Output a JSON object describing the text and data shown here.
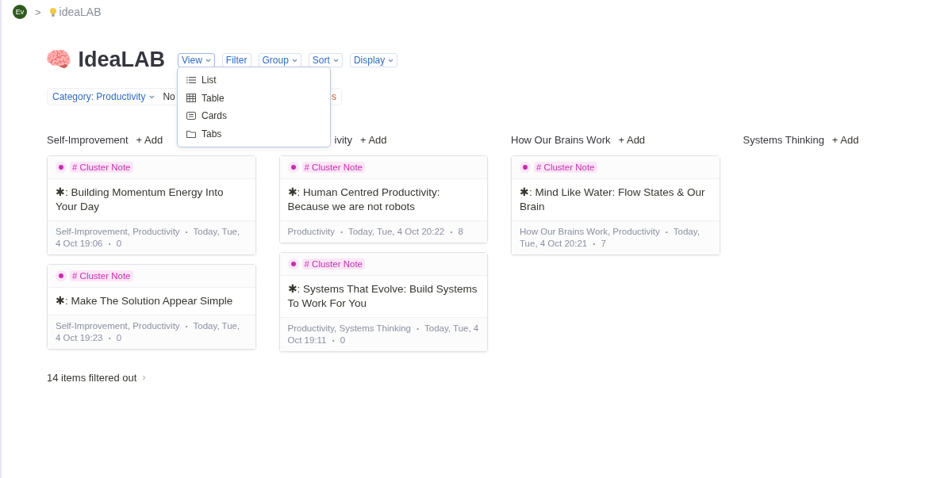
{
  "breadcrumb": {
    "avatar": "Ev",
    "separator": ">",
    "page": "ideaLAB"
  },
  "title": {
    "emoji": "🧠",
    "text": "IdeaLAB"
  },
  "meta_separator": "•",
  "toolbar": [
    {
      "label": "View",
      "caret": true,
      "selected": true
    },
    {
      "label": "Filter",
      "caret": false,
      "selected": false
    },
    {
      "label": "Group",
      "caret": true,
      "selected": false
    },
    {
      "label": "Sort",
      "caret": true,
      "selected": false
    },
    {
      "label": "Display",
      "caret": true,
      "selected": false
    }
  ],
  "filters": [
    {
      "kind": "dropdown",
      "label": "Category: Productivity"
    },
    {
      "kind": "plain",
      "label": "No"
    },
    {
      "kind": "warning",
      "label": "s"
    }
  ],
  "view_menu": [
    {
      "kind": "list",
      "label": "List"
    },
    {
      "kind": "table",
      "label": "Table"
    },
    {
      "kind": "cards",
      "label": "Cards"
    },
    {
      "kind": "tabs",
      "label": "Tabs"
    }
  ],
  "columns": [
    {
      "title": "Self-Improvement",
      "add": "+ Add",
      "cards": [
        {
          "tag": "# Cluster Note",
          "title": "✱: Building Momentum Energy Into Your Day",
          "meta": [
            "Self-Improvement, Productivity",
            "Today, Tue, 4 Oct 19:06",
            "0"
          ]
        },
        {
          "tag": "# Cluster Note",
          "title": "✱: Make The Solution Appear Simple",
          "meta": [
            "Self-Improvement, Productivity",
            "Today, Tue, 4 Oct 19:23",
            "0"
          ]
        }
      ]
    },
    {
      "title": "ivity",
      "add": "+ Add",
      "cards": [
        {
          "tag": "# Cluster Note",
          "title": "✱: Human Centred Productivity: Because we are not robots",
          "meta": [
            "Productivity",
            "Today, Tue, 4 Oct 20:22",
            "8"
          ]
        },
        {
          "tag": "# Cluster Note",
          "title": "✱: Systems That Evolve: Build Systems To Work For You",
          "meta": [
            "Productivity, Systems Thinking",
            "Today, Tue, 4 Oct 19:11",
            "0"
          ]
        }
      ]
    },
    {
      "title": "How Our Brains Work",
      "add": "+ Add",
      "cards": [
        {
          "tag": "# Cluster Note",
          "title": "✱: Mind Like Water: Flow States & Our Brain",
          "meta": [
            "How Our Brains Work, Productivity",
            "Today, Tue, 4 Oct 20:21",
            "7"
          ]
        }
      ]
    },
    {
      "title": "Systems Thinking",
      "add": "+ Add"
    }
  ],
  "filtered_out": {
    "label": "14 items filtered out",
    "chevron": "›"
  }
}
